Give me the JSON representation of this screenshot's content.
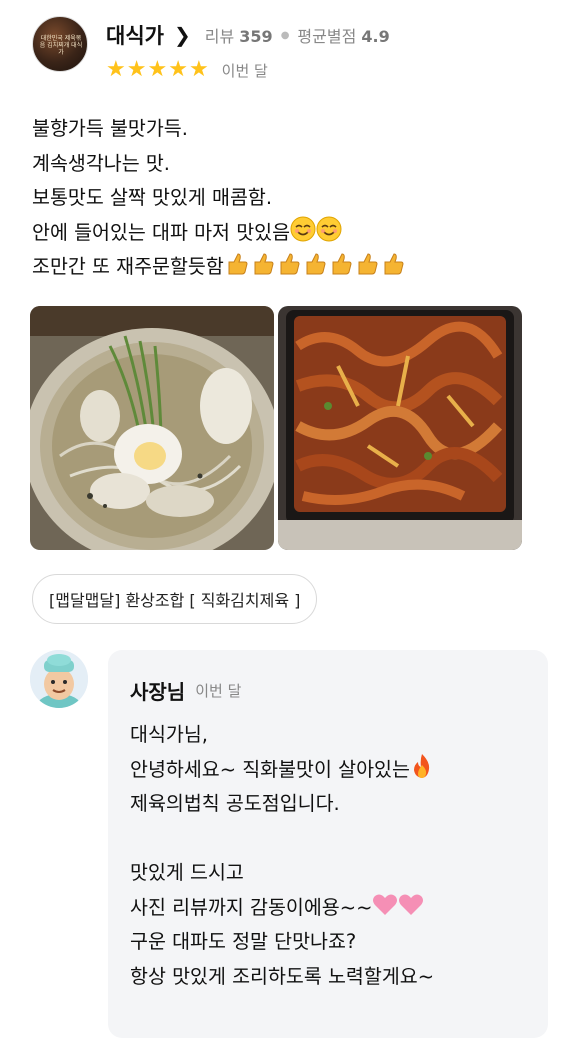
{
  "reviewer": {
    "name": "대식가",
    "review_count_label": "리뷰",
    "review_count": "359",
    "avg_rating_label": "평균별점",
    "avg_rating": "4.9",
    "stars": 5,
    "date": "이번 달",
    "avatar_text": "대한민국 제육볶음 김치찌개 대식가"
  },
  "review": {
    "lines": [
      "불향가득 불맛가득.",
      "계속생각나는 맛.",
      "보통맛도 살짝 맛있게 매콤함.",
      "안에 들어있는 대파 마저 맛있음",
      "조만간 또 재주문할듯함"
    ]
  },
  "photos": [
    "냉면 사진",
    "제육볶음 사진"
  ],
  "menu_tag": "[맵달맵달] 환상조합 [ 직화김치제육 ]",
  "owner_reply": {
    "name": "사장님",
    "date": "이번 달",
    "lines": [
      "대식가님,",
      "안녕하세요~ 직화불맛이 살아있는",
      "제육의법칙 공도점입니다.",
      "",
      "맛있게 드시고",
      "사진 리뷰까지 감동이에용~~",
      "구운 대파도 정말 단맛나죠?",
      "항상 맛있게 조리하도록 노력할게요~"
    ]
  },
  "colors": {
    "star": "#ffc21a",
    "muted_text": "#888888",
    "reply_background": "#f4f5f7"
  },
  "icons": [
    "chevron-right-icon",
    "star-icon",
    "smile-emoji-icon",
    "thumbs-up-emoji-icon",
    "fire-emoji-icon",
    "heart-emoji-icon"
  ]
}
